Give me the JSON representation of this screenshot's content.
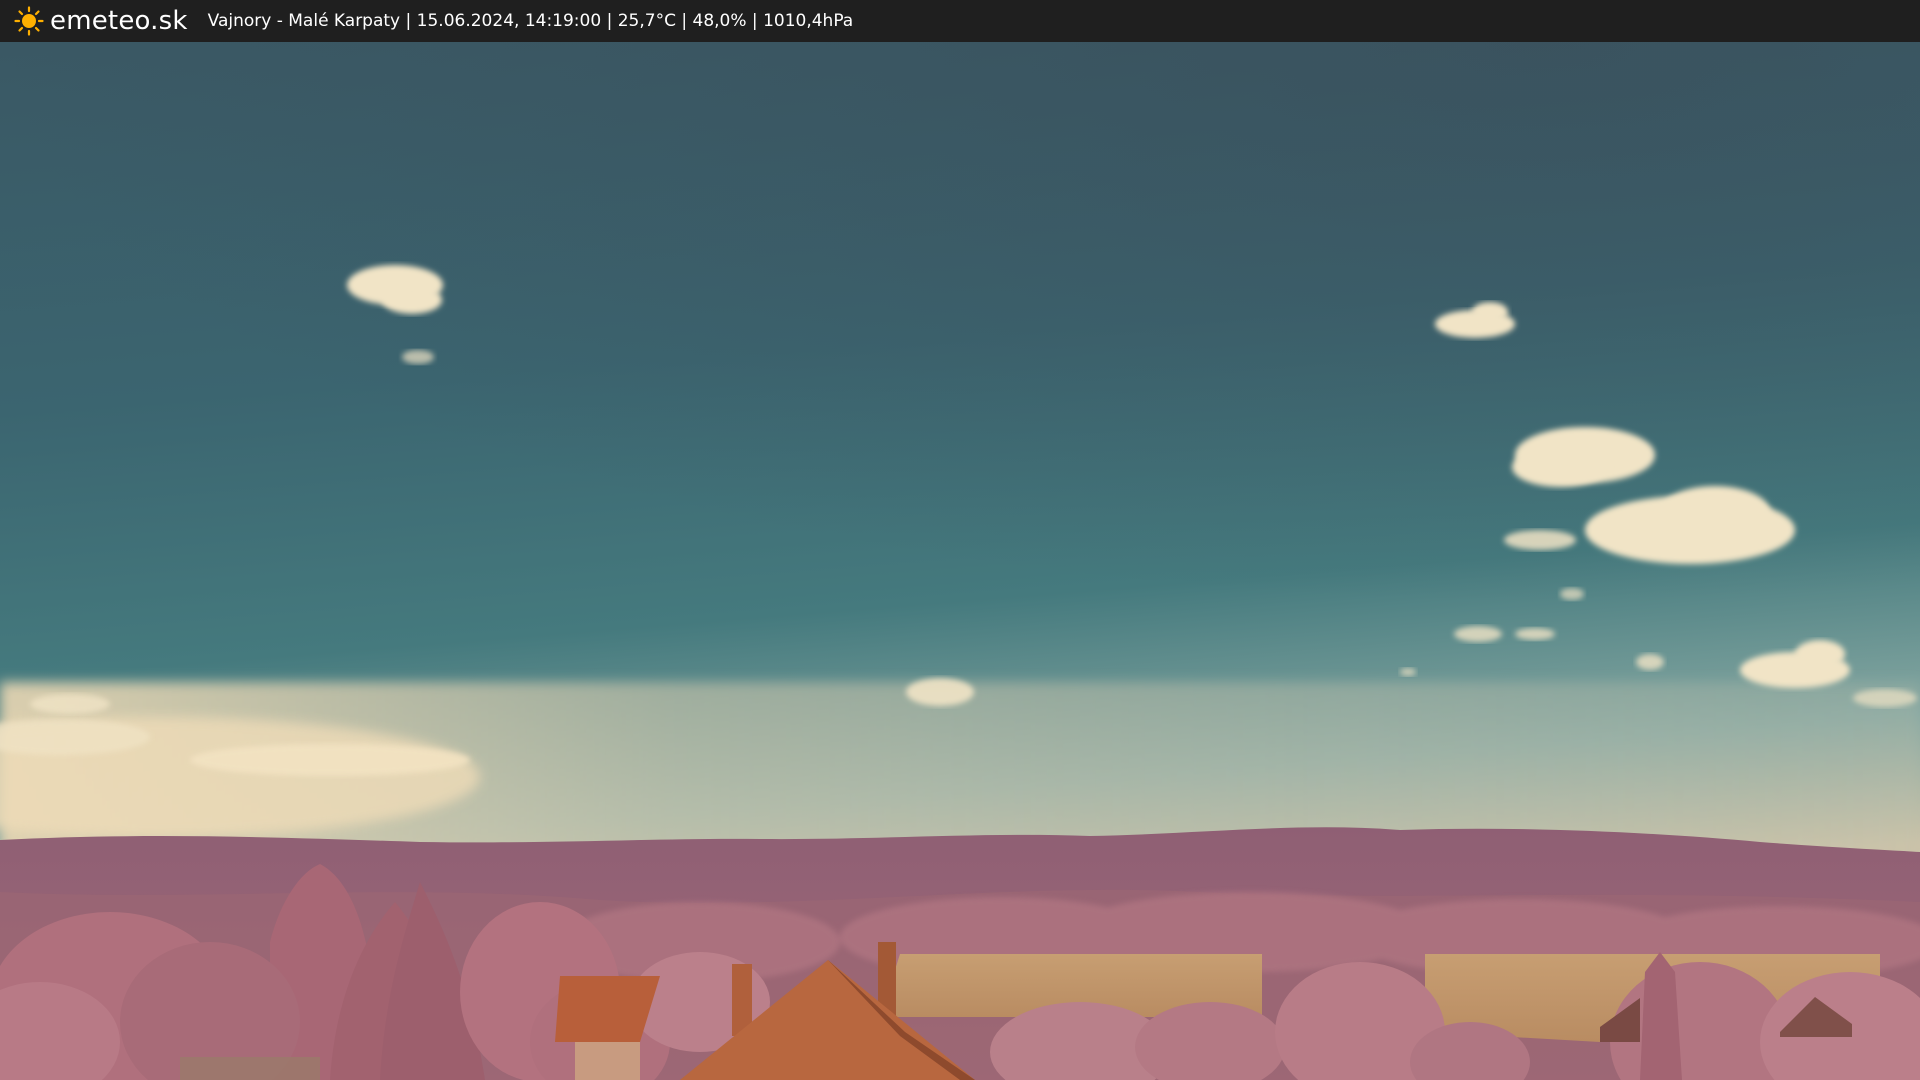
{
  "header": {
    "logo_icon": "sun-icon",
    "brand": "emeteo.sk",
    "location": "Vajnory - Malé Karpaty",
    "timestamp": "15.06.2024, 14:19:00",
    "temperature": "25,7°C",
    "humidity": "48,0%",
    "pressure": "1010,4hPa",
    "separator": " | "
  },
  "image": {
    "description_icon": "webcam-photo",
    "colors": {
      "sky_top": "#3f5560",
      "sky_mid": "#3b6d76",
      "sky_low": "#7aa3a2",
      "horizon_haze": "#d8c7a8",
      "hills": "#8e5e70",
      "trees": "#b5757e",
      "field": "#c79a6b",
      "roof": "#b8603a",
      "cloud": "#f0e2c4"
    }
  }
}
